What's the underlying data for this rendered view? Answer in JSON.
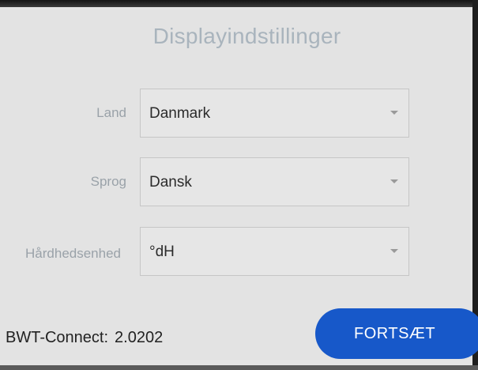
{
  "screen": {
    "title": "Displayindstillinger"
  },
  "form": {
    "country": {
      "label": "Land",
      "value": "Danmark"
    },
    "language": {
      "label": "Sprog",
      "value": "Dansk"
    },
    "hardness_unit": {
      "label": "Hårdhedsenhed",
      "value": "°dH"
    }
  },
  "footer": {
    "version_label": "BWT-Connect:",
    "version_value": "2.0202",
    "continue_label": "FORTSÆT"
  },
  "icons": {
    "dropdown": "caret-down-icon"
  },
  "colors": {
    "background": "#e3e3e3",
    "title": "#a9b4bd",
    "accent": "#1758c9"
  }
}
